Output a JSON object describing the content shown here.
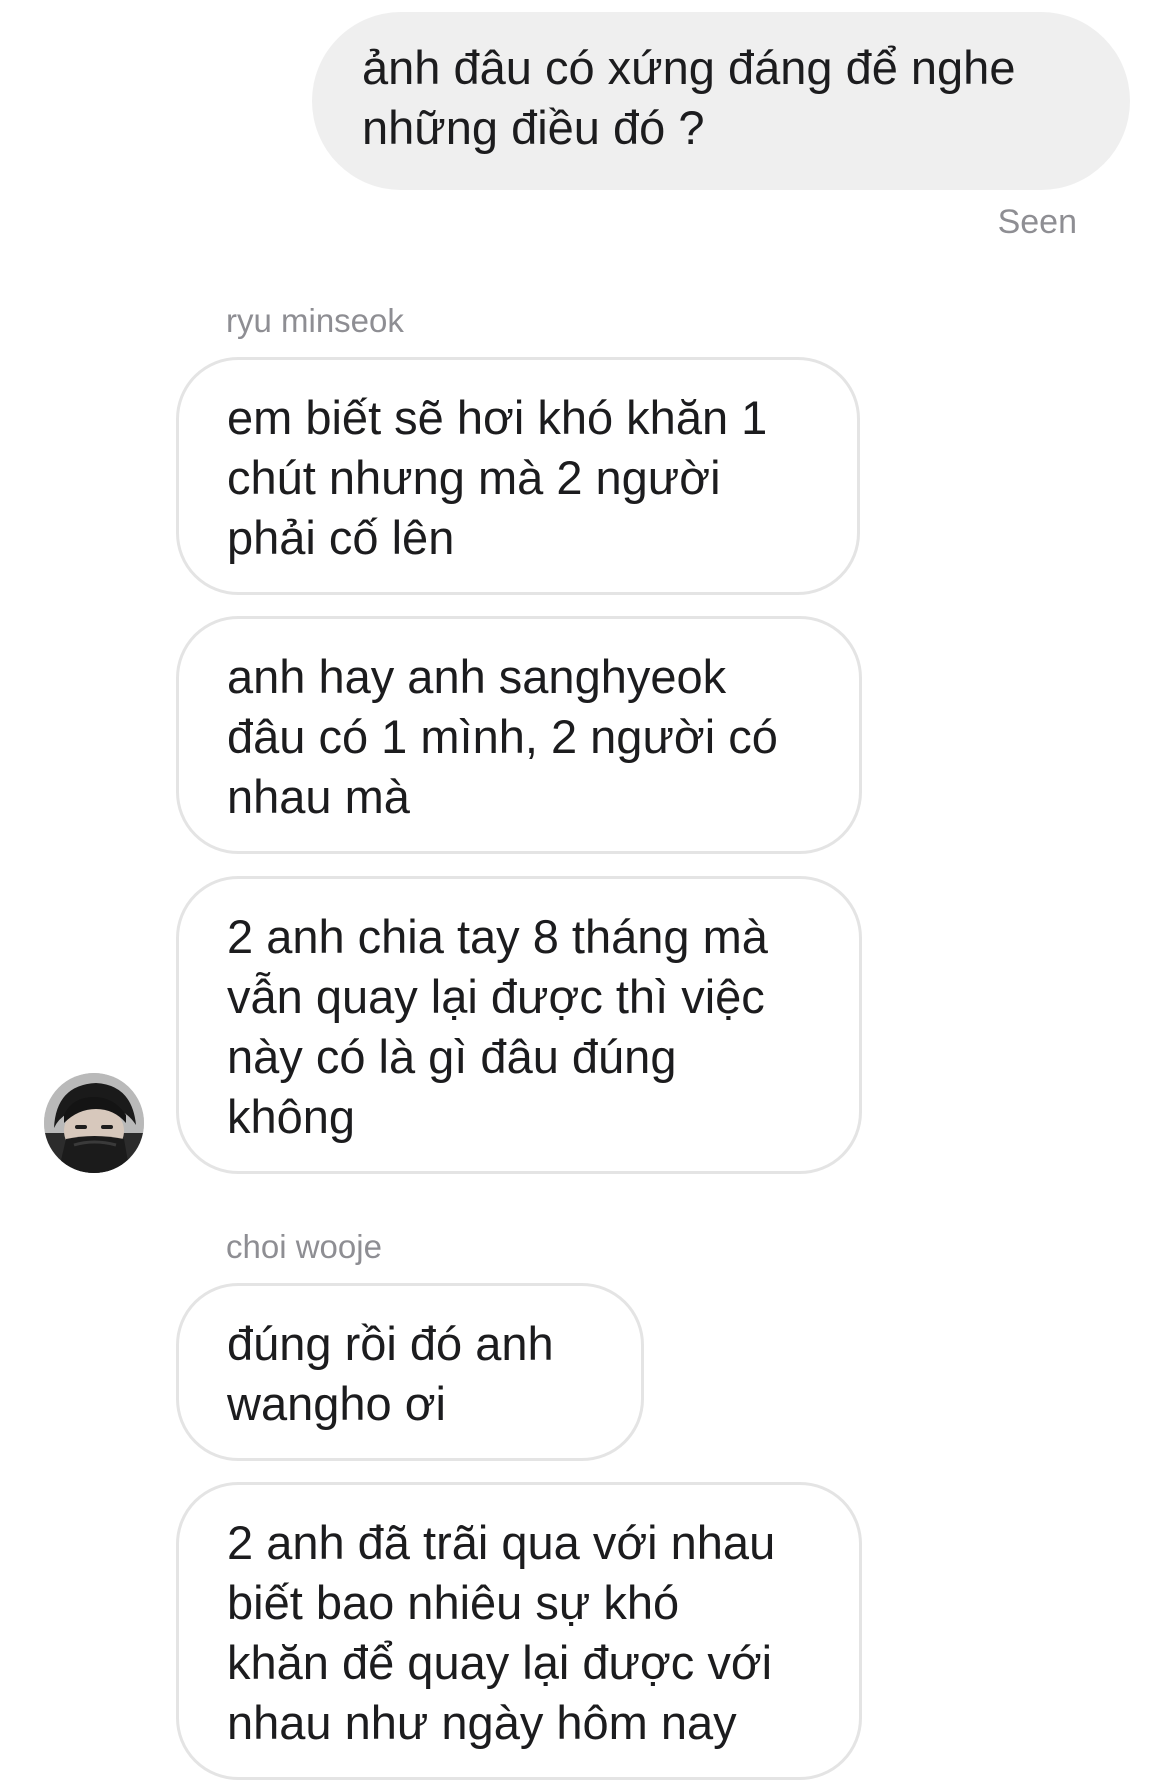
{
  "conversation": {
    "outgoing": {
      "text": "ảnh đâu có xứng đáng để nghe\nnhững điều đó ?",
      "status": "Seen"
    },
    "groups": [
      {
        "sender": "ryu minseok",
        "messages": [
          "em biết sẽ hơi khó khăn 1\nchút nhưng mà 2 người\nphải cố lên",
          "anh hay anh sanghyeok\nđâu có 1 mình, 2 người có\nnhau mà",
          "2 anh chia tay 8 tháng mà\nvẫn quay lại được thì việc\nnày có là gì đâu đúng\nkhông"
        ]
      },
      {
        "sender": "choi wooje",
        "messages": [
          "đúng rồi đó anh\nwangho ơi",
          "2 anh đã trãi qua với nhau\nbiết bao nhiêu sự khó\nkhăn để quay lại được với\nnhau như ngày hôm nay"
        ]
      }
    ]
  },
  "colors": {
    "outgoing_bubble": "#efefef",
    "incoming_border": "#e4e4e4",
    "meta_text": "#8e8e93",
    "message_text": "#1c1c1e"
  },
  "icons": {
    "avatar": "user-avatar-photo"
  }
}
